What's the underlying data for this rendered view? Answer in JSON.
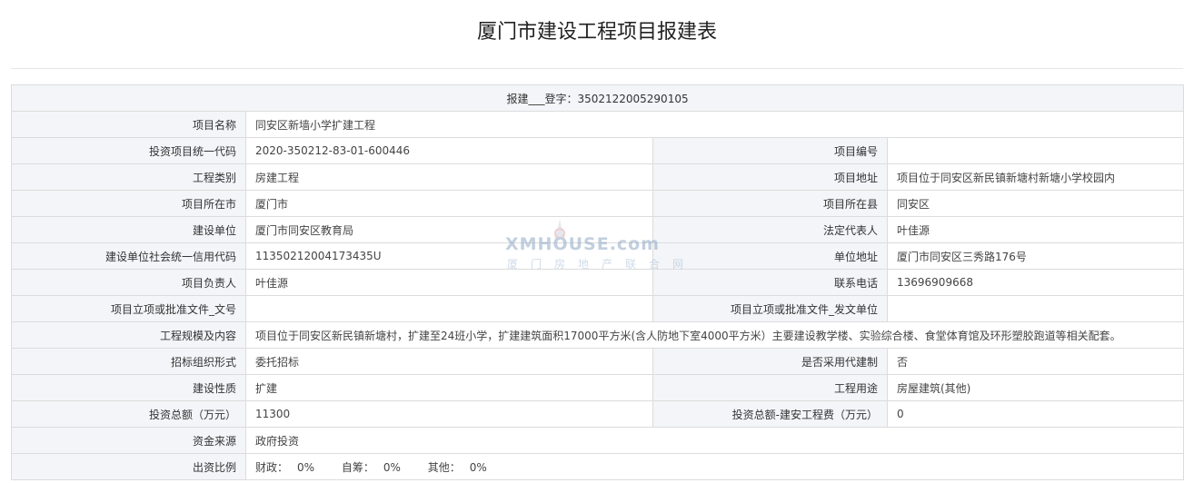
{
  "page": {
    "title": "厦门市建设工程项目报建表"
  },
  "header": {
    "registration": "报建___登字：3502122005290105"
  },
  "rows": {
    "project_name": {
      "label": "项目名称",
      "value": "同安区新墙小学扩建工程"
    },
    "investment_code": {
      "label": "投资项目统一代码",
      "value": "2020-350212-83-01-600446"
    },
    "project_number": {
      "label": "项目编号",
      "value": ""
    },
    "project_category": {
      "label": "工程类别",
      "value": "房建工程"
    },
    "project_address": {
      "label": "项目地址",
      "value": "项目位于同安区新民镇新塘村新塘小学校园内"
    },
    "city": {
      "label": "项目所在市",
      "value": "厦门市"
    },
    "county": {
      "label": "项目所在县",
      "value": "同安区"
    },
    "builder": {
      "label": "建设单位",
      "value": "厦门市同安区教育局"
    },
    "legal_rep": {
      "label": "法定代表人",
      "value": "叶佳源"
    },
    "credit_code": {
      "label": "建设单位社会统一信用代码",
      "value": "11350212004173435U"
    },
    "unit_address": {
      "label": "单位地址",
      "value": "厦门市同安区三秀路176号"
    },
    "manager": {
      "label": "项目负责人",
      "value": "叶佳源"
    },
    "phone": {
      "label": "联系电话",
      "value": "13696909668"
    },
    "approval_doc_no": {
      "label": "项目立项或批准文件_文号",
      "value": ""
    },
    "approval_issuer": {
      "label": "项目立项或批准文件_发文单位",
      "value": ""
    },
    "scale": {
      "label": "工程规模及内容",
      "value": "项目位于同安区新民镇新塘村，扩建至24班小学，扩建建筑面积17000平方米(含人防地下室4000平方米）主要建设教学楼、实验综合楼、食堂体育馆及环形塑胶跑道等相关配套。"
    },
    "bid_form": {
      "label": "招标组织形式",
      "value": "委托招标"
    },
    "agent_system": {
      "label": "是否采用代建制",
      "value": "否"
    },
    "nature": {
      "label": "建设性质",
      "value": "扩建"
    },
    "usage": {
      "label": "工程用途",
      "value": "房屋建筑(其他)"
    },
    "total_investment": {
      "label": "投资总额（万元）",
      "value": "11300"
    },
    "construction_cost": {
      "label": "投资总额-建安工程费（万元）",
      "value": "0"
    },
    "fund_source": {
      "label": "资金来源",
      "value": "政府投资"
    },
    "funding_ratio": {
      "label": "出资比例",
      "items": [
        {
          "label": "财政：",
          "value": "0%"
        },
        {
          "label": "自筹：",
          "value": "0%"
        },
        {
          "label": "其他：",
          "value": "0%"
        }
      ]
    }
  },
  "watermark": {
    "brand": "XMHOUSE.com",
    "subtitle": "厦门房地产联合网"
  },
  "colors": {
    "label_bg": "#f3f5f8",
    "border": "#dcdcdc",
    "watermark": "#8fa9c4"
  }
}
